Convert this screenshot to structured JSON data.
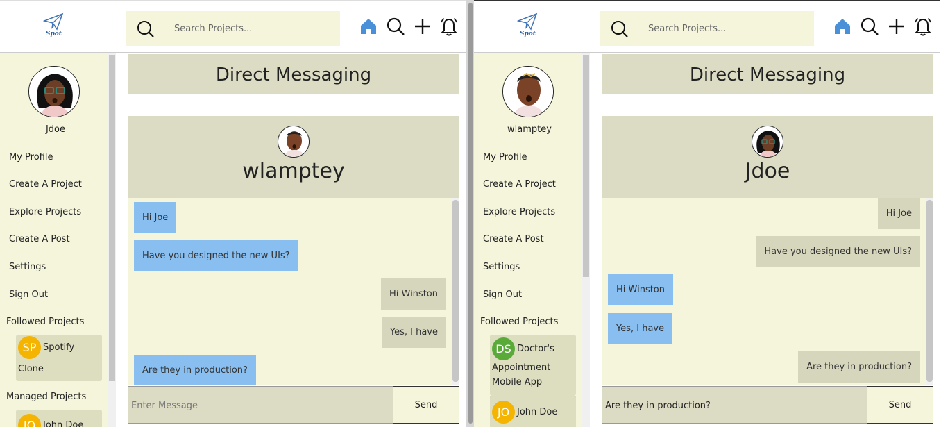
{
  "colors": {
    "accent_blue": "#88bef0",
    "panel_beige": "#f5f5dc",
    "panel_khaki": "#dcdcc4",
    "home_icon_blue": "#4a90d9"
  },
  "logo": {
    "text": "Spot",
    "icon": "paper-plane-icon"
  },
  "search": {
    "placeholder": "Search Projects..."
  },
  "header_icons": [
    "home-icon",
    "search-icon",
    "plus-icon",
    "bell-icon"
  ],
  "nav": [
    "My Profile",
    "Create A Project",
    "Explore Projects",
    "Create A Post",
    "Settings",
    "Sign Out"
  ],
  "page_title": "Direct Messaging",
  "composer": {
    "placeholder": "Enter Message",
    "send_label": "Send"
  },
  "left": {
    "user": "Jdoe",
    "followed_title": "Followed Projects",
    "managed_title": "Managed Projects",
    "followed": [
      {
        "initials": "SP",
        "name": "Spotify Clone",
        "color": "#f4b400"
      }
    ],
    "managed": [
      {
        "initials": "JO",
        "name": "John Doe",
        "color": "#f4b400"
      }
    ],
    "chat_with": "wlamptey",
    "composer_value": "",
    "messages": [
      {
        "text": "Hi Joe",
        "side": "left"
      },
      {
        "text": "Have you designed the new UIs?",
        "side": "left"
      },
      {
        "text": "Hi Winston",
        "side": "right"
      },
      {
        "text": "Yes, I have",
        "side": "right"
      },
      {
        "text": "Are they in production?",
        "side": "left"
      }
    ]
  },
  "right": {
    "user": "wlamptey",
    "followed_title": "Followed Projects",
    "followed": [
      {
        "initials": "DS",
        "name": "Doctor's Appointment Mobile App",
        "color": "#5aaa3a"
      },
      {
        "initials": "JO",
        "name": "John Doe",
        "color": "#f4b400"
      }
    ],
    "chat_with": "Jdoe",
    "composer_value": "Are they in production?",
    "messages": [
      {
        "text": "Hi Joe",
        "side": "right"
      },
      {
        "text": "Have you designed the new UIs?",
        "side": "right"
      },
      {
        "text": "Hi Winston",
        "side": "left"
      },
      {
        "text": "Yes, I have",
        "side": "left"
      },
      {
        "text": "Are they in production?",
        "side": "right"
      }
    ]
  }
}
